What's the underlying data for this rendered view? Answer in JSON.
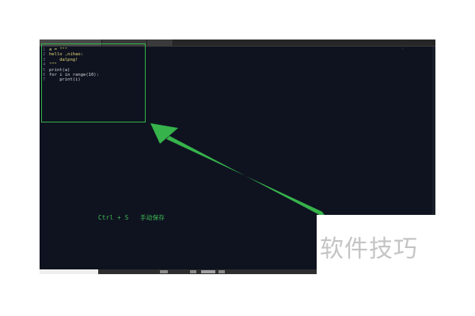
{
  "editor": {
    "code_lines": [
      {
        "num": "1",
        "text": "a = \"\"\""
      },
      {
        "num": "2",
        "text": "hello ,nihao:"
      },
      {
        "num": "3",
        "text": "    dalpng!"
      },
      {
        "num": "4",
        "text": "\"\"\""
      },
      {
        "num": "5",
        "text": "print(a)"
      },
      {
        "num": "6",
        "text": "for i in range(10):"
      },
      {
        "num": "7",
        "text": "    print(i)"
      }
    ],
    "minimap_glyph": "⁝"
  },
  "annotation": {
    "shortcut_text": "Ctrl + S   手动保存",
    "highlight_color": "#36b34a",
    "arrow_color": "#36b34a"
  },
  "watermark": {
    "text": "软件技巧"
  },
  "colors": {
    "editor_background": "#0f1320",
    "string_color": "#e6db74",
    "line_number_color": "#6b7080"
  }
}
